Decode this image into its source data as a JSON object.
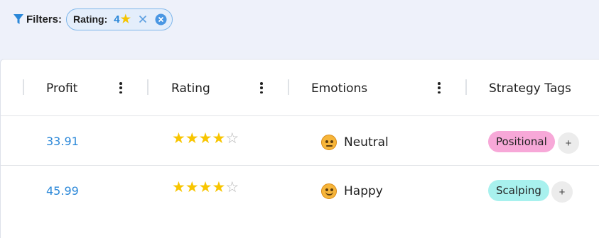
{
  "filters": {
    "label": "Filters:",
    "chip": {
      "label": "Rating:",
      "value": "4",
      "value_icon": "star-icon"
    }
  },
  "table": {
    "columns": [
      "Profit",
      "Rating",
      "Emotions",
      "Strategy Tags"
    ],
    "rows": [
      {
        "profit": "33.91",
        "rating": 4,
        "rating_max": 5,
        "emotion": "Neutral",
        "emotion_icon": "neutral-face-icon",
        "tag": "Positional",
        "tag_color": "#f7a8d8"
      },
      {
        "profit": "45.99",
        "rating": 4,
        "rating_max": 5,
        "emotion": "Happy",
        "emotion_icon": "smiling-face-icon",
        "tag": "Scalping",
        "tag_color": "#a8f1ee"
      }
    ],
    "add_tag_label": "+"
  },
  "colors": {
    "accent": "#2a87d8",
    "star": "#f8c500"
  }
}
